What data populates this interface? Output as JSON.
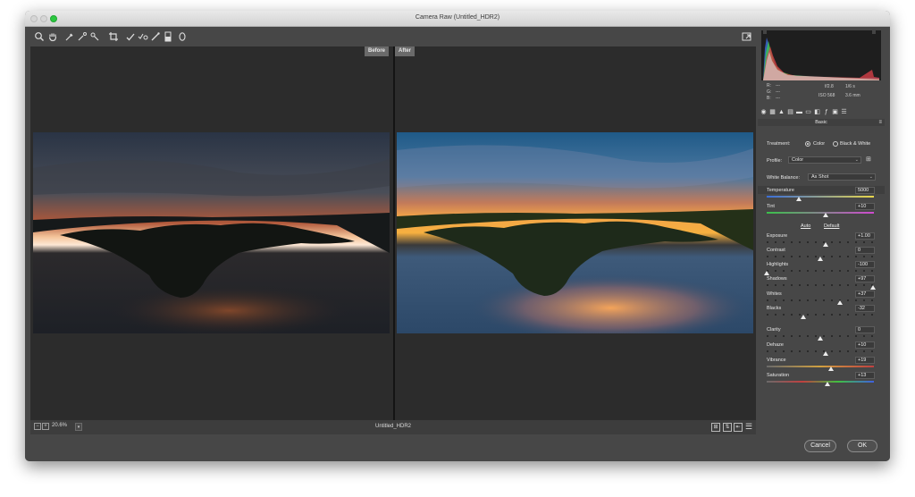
{
  "window": {
    "title": "Camera Raw (Untitled_HDR2)"
  },
  "toolbar": {
    "tools": [
      "zoom-icon",
      "hand-icon",
      "white-balance-icon",
      "color-sampler-icon",
      "targeted-adjustment-icon",
      "crop-icon",
      "spot-removal-icon",
      "red-eye-icon",
      "adjustment-brush-icon",
      "graduated-filter-icon",
      "radial-filter-icon"
    ],
    "fullscreen_icon": "fullscreen-toggle-icon"
  },
  "preview": {
    "before_label": "Before",
    "after_label": "After"
  },
  "bottombar": {
    "zoom": "20.6%",
    "filename": "Untitled_HDR2"
  },
  "panel": {
    "readout": {
      "r_label": "R:",
      "g_label": "G:",
      "b_label": "B:",
      "r_value": "---",
      "g_value": "---",
      "b_value": "---",
      "aperture": "f/2.8",
      "shutter": "1/6 s",
      "iso": "ISO 568",
      "focal": "3.6 mm"
    },
    "section_title": "Basic",
    "treatment_label": "Treatment:",
    "treatment_color": "Color",
    "treatment_bw": "Black & White",
    "profile_label": "Profile:",
    "profile_value": "Color",
    "wb_label": "White Balance:",
    "wb_value": "As Shot",
    "auto_label": "Auto",
    "default_label": "Default",
    "sliders": [
      {
        "label": "Temperature",
        "value": "5000",
        "level": 0.3
      },
      {
        "label": "Tint",
        "value": "+10",
        "level": 0.55
      },
      {
        "label": "Exposure",
        "value": "+1.00",
        "level": 0.55
      },
      {
        "label": "Contrast",
        "value": "0",
        "level": 0.5
      },
      {
        "label": "Highlights",
        "value": "-100",
        "level": 0.0
      },
      {
        "label": "Shadows",
        "value": "+97",
        "level": 0.99
      },
      {
        "label": "Whites",
        "value": "+37",
        "level": 0.68
      },
      {
        "label": "Blacks",
        "value": "-32",
        "level": 0.34
      },
      {
        "label": "Clarity",
        "value": "0",
        "level": 0.5
      },
      {
        "label": "Dehaze",
        "value": "+10",
        "level": 0.55
      },
      {
        "label": "Vibrance",
        "value": "+19",
        "level": 0.6
      },
      {
        "label": "Saturation",
        "value": "+13",
        "level": 0.57
      }
    ]
  },
  "footer": {
    "cancel_label": "Cancel",
    "ok_label": "OK"
  }
}
